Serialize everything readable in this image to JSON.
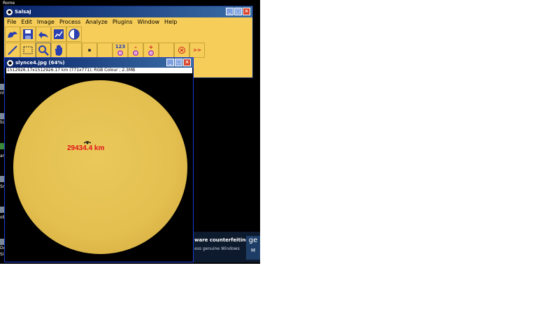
{
  "desktop": {
    "top_label": "Rome",
    "edge_labels": [
      "nl",
      "lic",
      "ar",
      "Sr",
      "obl",
      "De",
      "Si"
    ],
    "wga": {
      "line1": "ware counterfeiting.",
      "line2": "ess genuine Windows",
      "badge_line1": "ge",
      "badge_line2": "M"
    }
  },
  "app_window": {
    "title": "SalsaJ",
    "menu": [
      "File",
      "Edit",
      "Image",
      "Process",
      "Analyze",
      "Plugins",
      "Window",
      "Help"
    ],
    "tool_labels": {
      "count": "123",
      "minus": "-",
      "plus": "+",
      "more": ">>"
    },
    "colors": {
      "window_bg": "#f6cd58",
      "title_bar": "#0a246a"
    }
  },
  "image_window": {
    "title": "slynce4.jpg (64%)",
    "info": "1512926.17x1512926.17 km (771x771); RGB Colour ; 2.3MB",
    "measurement": "29434.4 km",
    "colors": {
      "sun": "#e3bf4f",
      "measurement_text": "#e0121c"
    }
  }
}
